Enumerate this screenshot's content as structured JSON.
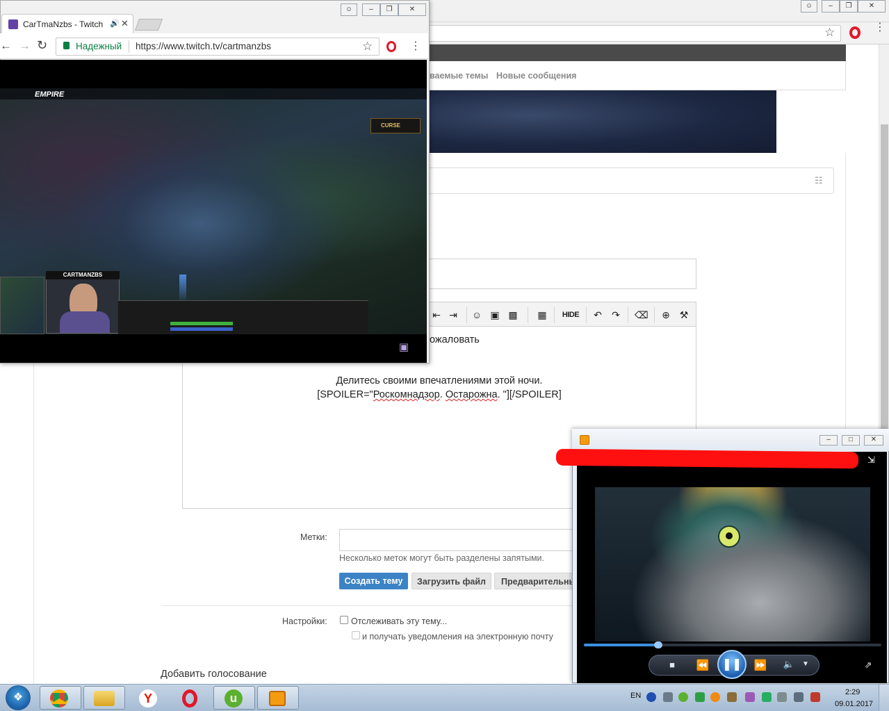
{
  "forum": {
    "nav_watched": "ваемые темы",
    "nav_new": "Новые сообщения",
    "editor": {
      "line1": "ожаловать",
      "line2": "Делитесь своими впечатлениями этой ночи.",
      "line3_pre": "[SPOILER=\"",
      "line3_w1": "Роскомнадзор",
      "line3_mid": ". ",
      "line3_w2": "Остарожна",
      "line3_post": ". \"][/SPOILER]",
      "toolbar_hide": "HIDE"
    },
    "tags_label": "Метки:",
    "tags_hint": "Несколько меток могут быть разделены запятыми.",
    "btn_create": "Создать тему",
    "btn_upload": "Загрузить файл",
    "btn_preview": "Предварительны",
    "settings_label": "Настройки:",
    "watch_thread": "Отслеживать эту тему...",
    "email_notify": "и получать уведомления на электронную почту",
    "poll_heading": "Добавить голосование"
  },
  "twitch_window": {
    "tab_title": "CarTmaNzbs - Twitch",
    "secure_label": "Надежный",
    "url": "https://www.twitch.tv/cartmanzbs",
    "hud_logo": "EMPIRE",
    "webcam_title": "CARTMANZBS",
    "curse_label": "CURSE"
  },
  "media_player": {
    "progress": 0.25
  },
  "taskbar": {
    "lang": "EN",
    "time": "2:29",
    "date": "09.01.2017"
  },
  "colors": {
    "create_button": "#3c83c6",
    "opera_red": "#e0182b",
    "twitch_purple": "#6441a5",
    "secure_green": "#0b8043",
    "redaction": "#ff1010"
  }
}
